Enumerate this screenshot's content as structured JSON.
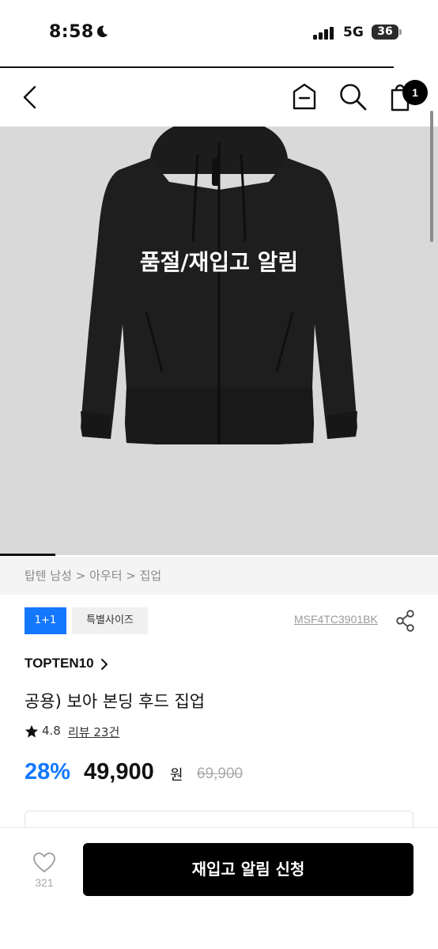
{
  "status_bar": {
    "time": "8:58",
    "network": "5G",
    "battery": "36"
  },
  "nav": {
    "cart_count": "1"
  },
  "product_image": {
    "overlay_text": "품절/재입고 알림",
    "background_color": "#d9d9d9"
  },
  "breadcrumb": {
    "items": [
      "탑텐 남성",
      "아우터",
      "집업"
    ],
    "separator": ">"
  },
  "tags": {
    "promo": "1+1",
    "size": "특별사이즈"
  },
  "product": {
    "code": "MSF4TC3901BK",
    "brand": "TOPTEN10",
    "name": "공용) 보아 본딩 후드 집업",
    "rating": "4.8",
    "review_label": "리뷰 23건",
    "discount": "28%",
    "price": "49,900",
    "currency": "원",
    "original_price": "69,900"
  },
  "bottom_bar": {
    "wish_count": "321",
    "cta_label": "재입고 알림 신청"
  },
  "colors": {
    "accent_blue": "#1478ff",
    "cta_black": "#000000"
  },
  "icons": [
    "back-icon",
    "home-icon",
    "search-icon",
    "cart-icon",
    "share-icon",
    "chevron-right-icon",
    "star-icon",
    "heart-icon",
    "moon-icon",
    "signal-icon",
    "battery-icon"
  ]
}
